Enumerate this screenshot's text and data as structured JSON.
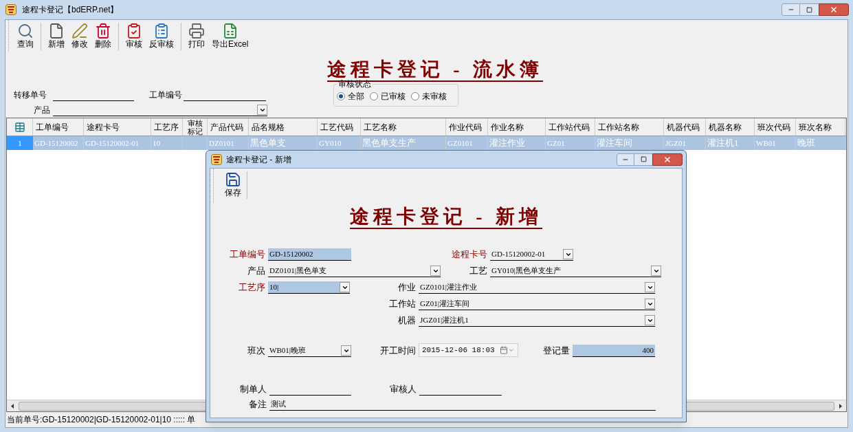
{
  "window": {
    "title": "途程卡登记【bdERP.net】"
  },
  "toolbar": [
    {
      "kind": "search",
      "label": "查询"
    },
    {
      "kind": "new",
      "label": "新增"
    },
    {
      "kind": "edit",
      "label": "修改"
    },
    {
      "kind": "delete",
      "label": "删除"
    },
    {
      "kind": "approve",
      "label": "审核"
    },
    {
      "kind": "unapprove",
      "label": "反审核"
    },
    {
      "kind": "print",
      "label": "打印"
    },
    {
      "kind": "excel",
      "label": "导出Excel"
    }
  ],
  "page_title": "途程卡登记 - 流水簿",
  "filters": {
    "transfer_no": {
      "label": "转移单号"
    },
    "work_order": {
      "label": "工单编号"
    },
    "product": {
      "label": "产品"
    }
  },
  "approval_status": {
    "legend": "审核状态",
    "options": [
      {
        "label": "全部",
        "selected": true
      },
      {
        "label": "已审核",
        "selected": false
      },
      {
        "label": "未审核",
        "selected": false
      }
    ]
  },
  "table": {
    "columns": [
      "工单编号",
      "途程卡号",
      "工艺序",
      "审核标记",
      "产品代码",
      "品名规格",
      "工艺代码",
      "工艺名称",
      "作业代码",
      "作业名称",
      "工作站代码",
      "工作站名称",
      "机器代码",
      "机器名称",
      "班次代码",
      "班次名称"
    ],
    "rows": [
      {
        "index": "1",
        "selected": true,
        "cells": [
          "GD-15120002",
          "GD-15120002-01",
          "10",
          "",
          "DZ0101",
          "黑色单支",
          "GY010",
          "黑色单支生产",
          "GZ0101",
          "灌注作业",
          "GZ01",
          "灌注车间",
          "JGZ01",
          "灌注机1",
          "WB01",
          "晚班"
        ]
      }
    ]
  },
  "status_bar": "当前单号:GD-15120002|GD-15120002-01|10 ::::: 单",
  "dialog": {
    "title": "途程卡登记 - 新增",
    "toolbar": [
      {
        "kind": "save",
        "label": "保存"
      }
    ],
    "heading": "途程卡登记 - 新增",
    "fields": {
      "work_order": {
        "label": "工单编号",
        "value": "GD-15120002",
        "required": true,
        "highlighted": true
      },
      "route_card": {
        "label": "途程卡号",
        "value": "GD-15120002-01",
        "required": true,
        "highlighted": false
      },
      "product": {
        "label": "产品",
        "value": "DZ0101|黑色单支",
        "required": false,
        "highlighted": false
      },
      "process": {
        "label": "工艺",
        "value": "GY010|黑色单支生产",
        "required": false,
        "highlighted": false
      },
      "sequence": {
        "label": "工艺序",
        "value": "10|",
        "required": true,
        "highlighted": true
      },
      "operation": {
        "label": "作业",
        "value": "GZ0101|灌注作业",
        "required": false,
        "highlighted": false
      },
      "workstation": {
        "label": "工作站",
        "value": "GZ01|灌注车间",
        "required": false,
        "highlighted": false
      },
      "machine": {
        "label": "机器",
        "value": "JGZ01|灌注机1",
        "required": false,
        "highlighted": false
      },
      "shift": {
        "label": "班次",
        "value": "WB01|晚班",
        "required": false,
        "highlighted": false
      },
      "start_time": {
        "label": "开工时间",
        "value": "2015-12-06 18:03",
        "required": false,
        "highlighted": false
      },
      "quantity": {
        "label": "登记量",
        "value": "400",
        "required": false,
        "highlighted": true
      },
      "creator": {
        "label": "制单人",
        "required": false,
        "highlighted": false
      },
      "reviewer": {
        "label": "审核人",
        "required": false,
        "highlighted": false
      },
      "remark": {
        "label": "备注",
        "value": "测试",
        "required": false,
        "highlighted": false
      }
    }
  }
}
